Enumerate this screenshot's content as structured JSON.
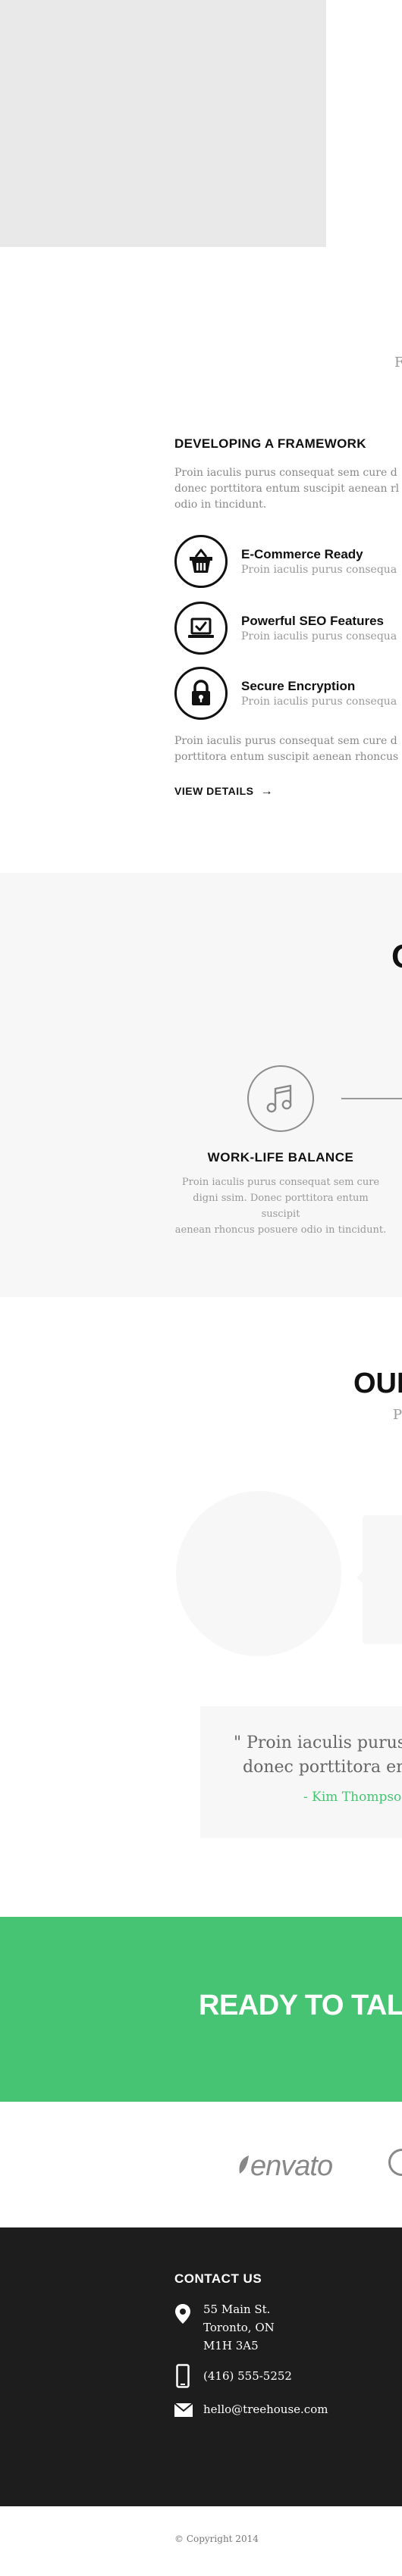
{
  "hero": {
    "cut_letter": "F"
  },
  "framework": {
    "heading": "DEVELOPING A FRAMEWORK",
    "intro_lines": [
      "Proin iaculis purus consequat sem cure  d",
      "donec porttitora entum suscipit  aenean rl",
      "odio in tincidunt."
    ],
    "features": [
      {
        "icon": "basket-icon",
        "title": "E-Commerce Ready",
        "desc": "Proin iaculis purus consequa"
      },
      {
        "icon": "laptop-check-icon",
        "title": "Powerful SEO Features",
        "desc": "Proin iaculis purus consequa"
      },
      {
        "icon": "lock-icon",
        "title": "Secure Encryption",
        "desc": "Proin iaculis purus consequa"
      }
    ],
    "outro_lines": [
      "Proin iaculis purus consequat sem cure  d",
      "porttitora entum suscipit  aenean rhoncus"
    ],
    "view_details": "VIEW DETAILS",
    "arrow": "→"
  },
  "services": {
    "cut_heading": "O",
    "item_icon": "music-note-icon",
    "item_title": "WORK-LIFE BALANCE",
    "item_desc_lines": [
      "Proin iaculis purus consequat sem cure",
      "digni ssim. Donec porttitora entum suscipit",
      "aenean rhoncus posuere odio in tincidunt."
    ]
  },
  "team": {
    "heading_cut": "OUI",
    "sub_cut": "P",
    "quote_line1": "\" Proin iaculis purus c",
    "quote_line2": "donec porttitora ent",
    "quote_author": "- Kim Thompso"
  },
  "cta": {
    "text": "READY TO TAL"
  },
  "logos": {
    "envato": "envato"
  },
  "footer": {
    "contact_title": "CONTACT US",
    "address_lines": [
      "55 Main St.",
      "Toronto, ON",
      "M1H 3A5"
    ],
    "phone": "(416) 555-5252",
    "email": "hello@treehouse.com",
    "copyright": "© Copyright 2014"
  },
  "colors": {
    "accent_green": "#47c473",
    "footer_bg": "#1d1d1d",
    "band_bg": "#f7f7f7"
  }
}
